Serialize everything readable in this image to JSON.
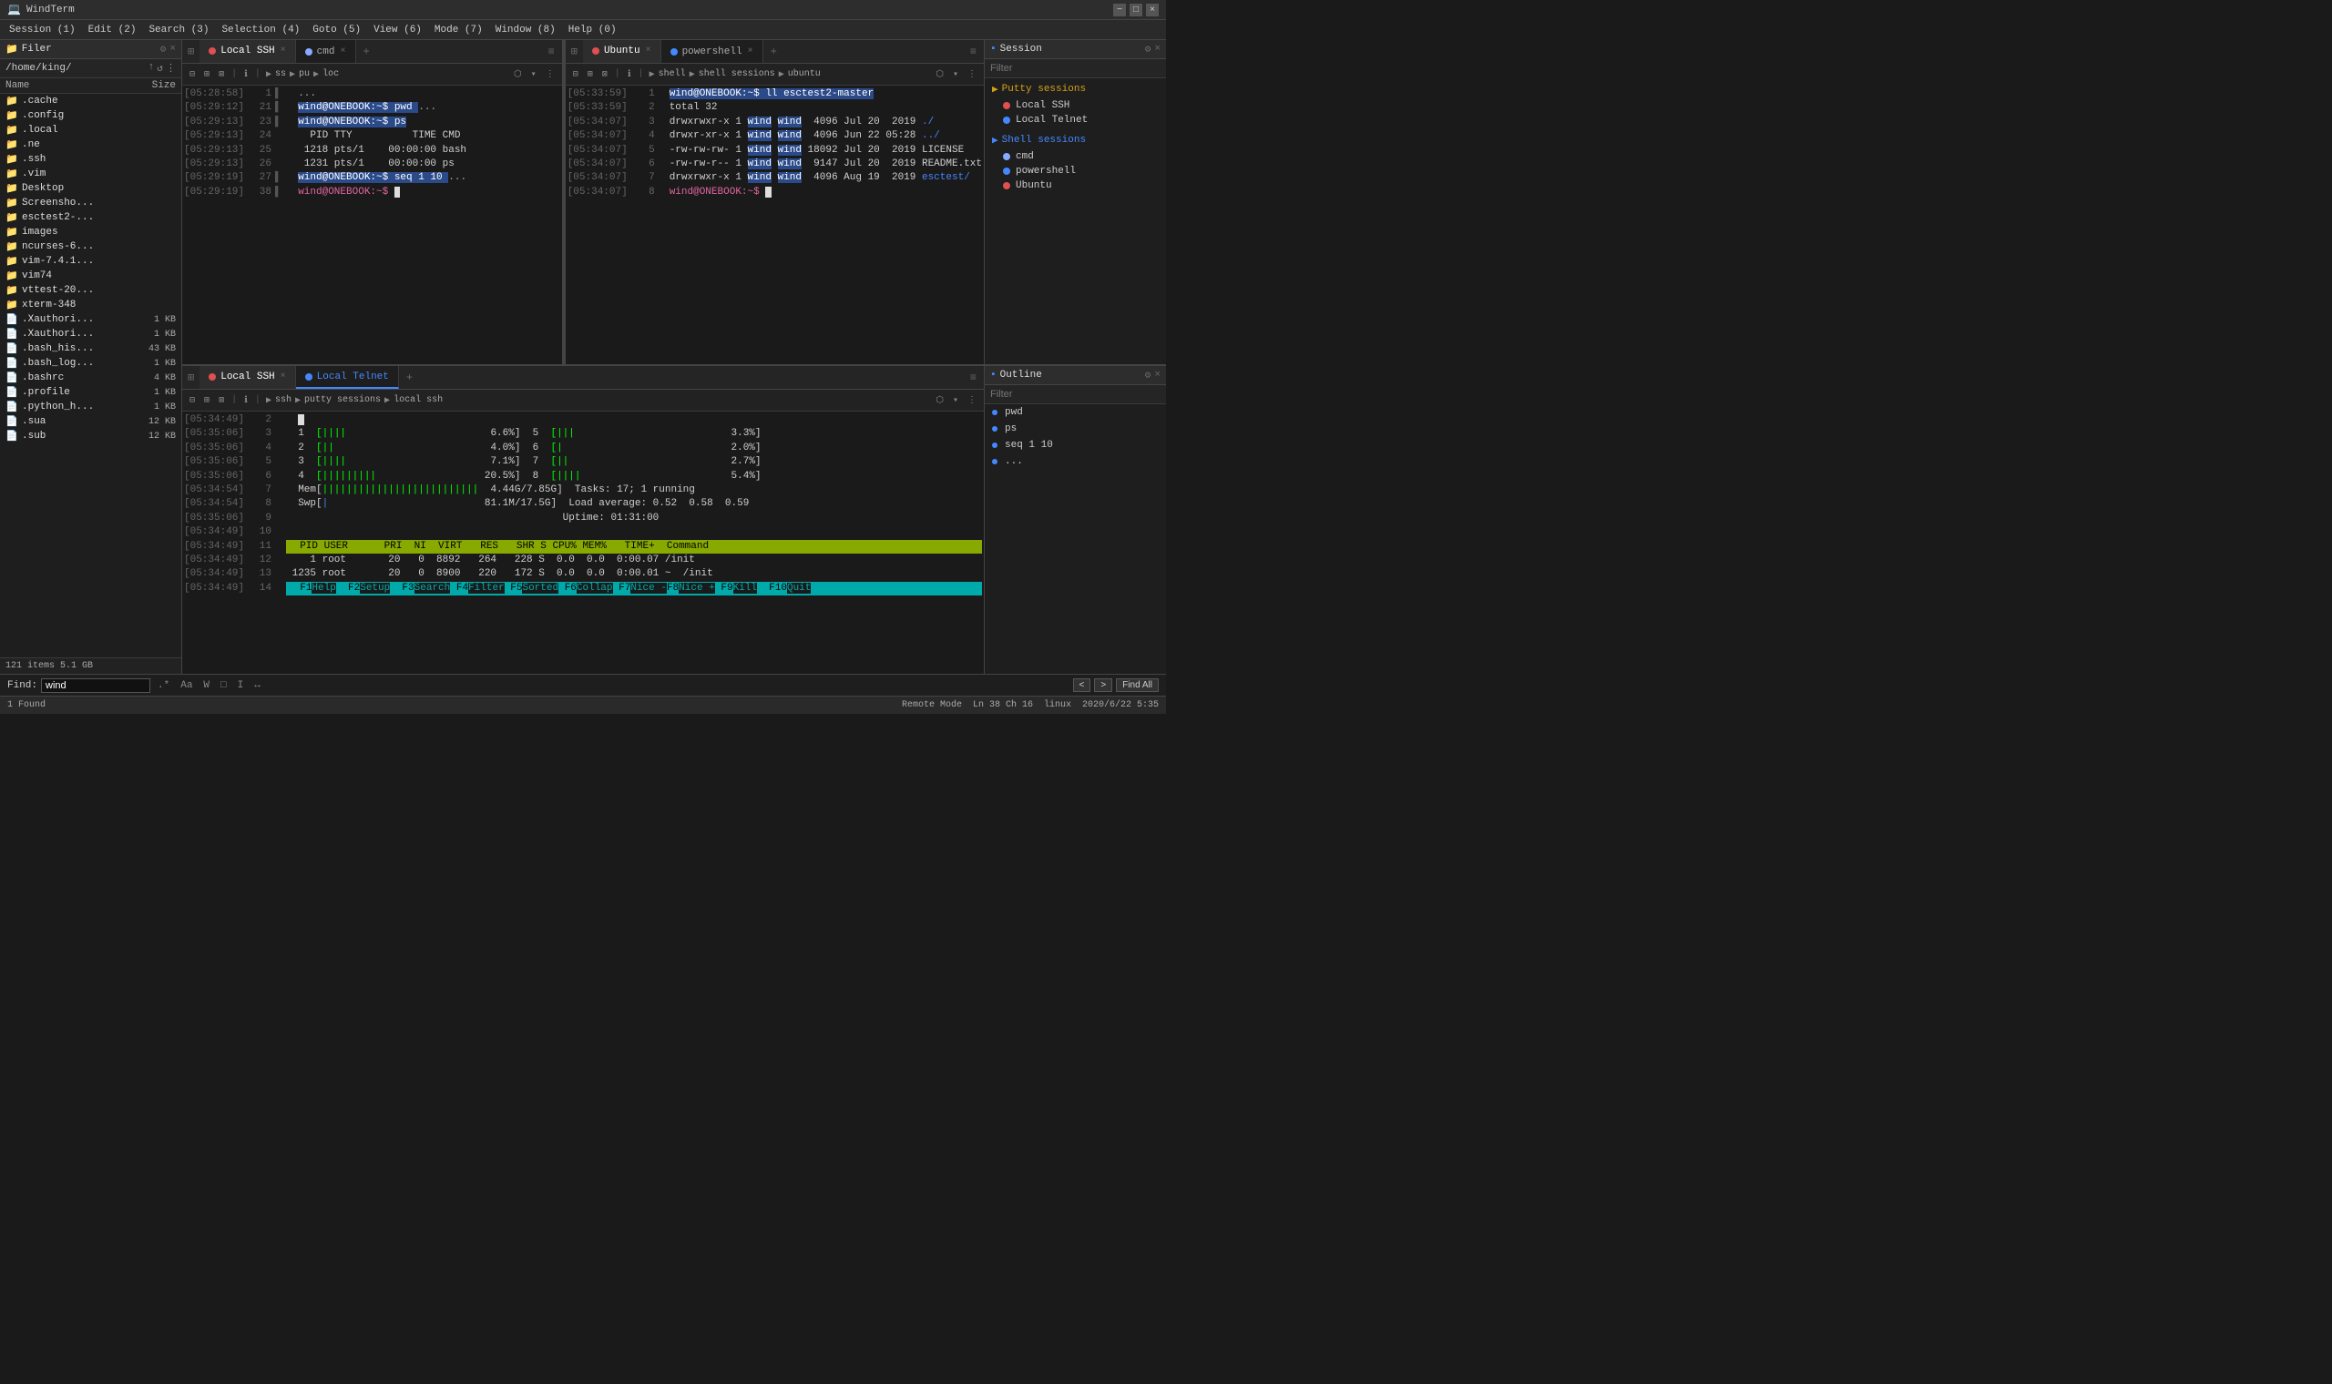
{
  "titlebar": {
    "title": "WindTerm",
    "min": "−",
    "max": "□",
    "close": "×"
  },
  "menubar": {
    "items": [
      "Session (1)",
      "Edit (2)",
      "Search (3)",
      "Selection (4)",
      "Goto (5)",
      "View (6)",
      "Mode (7)",
      "Window (8)",
      "Help (0)"
    ]
  },
  "filer": {
    "title": "Filer",
    "path": "/home/king/",
    "cols": {
      "name": "Name",
      "size": "Size"
    },
    "items": [
      {
        "name": ".cache",
        "type": "folder",
        "size": ""
      },
      {
        "name": ".config",
        "type": "folder",
        "size": ""
      },
      {
        "name": ".local",
        "type": "folder",
        "size": ""
      },
      {
        "name": ".ne",
        "type": "folder",
        "size": ""
      },
      {
        "name": ".ssh",
        "type": "folder",
        "size": ""
      },
      {
        "name": ".vim",
        "type": "folder",
        "size": ""
      },
      {
        "name": "Desktop",
        "type": "folder",
        "size": ""
      },
      {
        "name": "Screensho...",
        "type": "folder",
        "size": ""
      },
      {
        "name": "esctest2-...",
        "type": "folder",
        "size": ""
      },
      {
        "name": "images",
        "type": "folder",
        "size": ""
      },
      {
        "name": "ncurses-6...",
        "type": "folder",
        "size": ""
      },
      {
        "name": "vim-7.4.1...",
        "type": "folder",
        "size": ""
      },
      {
        "name": "vim74",
        "type": "folder",
        "size": ""
      },
      {
        "name": "vttest-20...",
        "type": "folder",
        "size": ""
      },
      {
        "name": "xterm-348",
        "type": "folder",
        "size": ""
      },
      {
        "name": ".Xauthori...",
        "type": "file",
        "size": "1 KB"
      },
      {
        "name": ".Xauthori...",
        "type": "file",
        "size": "1 KB"
      },
      {
        "name": ".bash_his...",
        "type": "file",
        "size": "43 KB"
      },
      {
        "name": ".bash_log...",
        "type": "file",
        "size": "1 KB"
      },
      {
        "name": ".bashrc",
        "type": "file",
        "size": "4 KB"
      },
      {
        "name": ".profile",
        "type": "file",
        "size": "1 KB"
      },
      {
        "name": ".python_h...",
        "type": "file",
        "size": "1 KB"
      },
      {
        "name": ".sua",
        "type": "file",
        "size": "12 KB"
      },
      {
        "name": ".sub",
        "type": "file",
        "size": "12 KB"
      }
    ],
    "footer": "121 items  5.1 GB"
  },
  "top_left": {
    "tabs": [
      {
        "label": "Local SSH",
        "dot_color": "#e05050",
        "active": true
      },
      {
        "label": "cmd",
        "dot_color": "#88aaff",
        "active": false
      }
    ],
    "toolbar": {
      "path": [
        "ss",
        "pu",
        "loc"
      ]
    },
    "lines": [
      {
        "time": "[05:28:58]",
        "num": "1",
        "ind": "▌",
        "content": "  ..."
      },
      {
        "time": "[05:29:12]",
        "num": "21",
        "ind": "▌",
        "content": "  wind@ONEBOOK:~$ pwd ..."
      },
      {
        "time": "[05:29:13]",
        "num": "23",
        "ind": "▌",
        "content": "  wind@ONEBOOK:~$ ps"
      },
      {
        "time": "[05:29:13]",
        "num": "24",
        "ind": " ",
        "content": "    PID TTY          TIME CMD"
      },
      {
        "time": "[05:29:13]",
        "num": "25",
        "ind": " ",
        "content": "   1218 pts/1    00:00:00 bash"
      },
      {
        "time": "[05:29:13]",
        "num": "26",
        "ind": " ",
        "content": "   1231 pts/1    00:00:00 ps"
      },
      {
        "time": "[05:29:19]",
        "num": "27",
        "ind": "▌",
        "content": "  wind@ONEBOOK:~$ seq 1 10 ..."
      },
      {
        "time": "[05:29:19]",
        "num": "38",
        "ind": "▌",
        "content": "  wind@ONEBOOK:~$ "
      }
    ]
  },
  "top_right": {
    "tabs": [
      {
        "label": "Ubuntu",
        "dot_color": "#e05050",
        "active": true
      },
      {
        "label": "powershell",
        "dot_color": "#4488ff",
        "active": false
      }
    ],
    "toolbar": {
      "path": [
        "shell",
        "shell sessions",
        "ubuntu"
      ]
    },
    "lines": [
      {
        "time": "[05:33:59]",
        "num": "1",
        "content": "  wind@ONEBOOK:~$ ll esctest2-master"
      },
      {
        "time": "[05:33:59]",
        "num": "2",
        "content": "  total 32"
      },
      {
        "time": "[05:34:07]",
        "num": "3",
        "content": "  drwxrwxr-x 1 wind wind  4096 Jul 20  2019 ./"
      },
      {
        "time": "[05:34:07]",
        "num": "4",
        "content": "  drwxr-xr-x 1 wind wind  4096 Jun 22 05:28 ../"
      },
      {
        "time": "[05:34:07]",
        "num": "5",
        "content": "  -rw-rw-rw- 1 wind wind 18092 Jul 20  2019 LICENSE"
      },
      {
        "time": "[05:34:07]",
        "num": "6",
        "content": "  -rw-rw-r-- 1 wind wind  9147 Jul 20  2019 README.txt"
      },
      {
        "time": "[05:34:07]",
        "num": "7",
        "content": "  drwxrwxr-x 1 wind wind  4096 Aug 19  2019 esctest/"
      },
      {
        "time": "[05:34:07]",
        "num": "8",
        "content": "  wind@ONEBOOK:~$ "
      }
    ]
  },
  "bottom": {
    "tabs": [
      {
        "label": "Local SSH",
        "dot_color": "#e05050",
        "active": true
      },
      {
        "label": "Local Telnet",
        "dot_color": "#4488ff",
        "active": false
      }
    ],
    "toolbar": {
      "path": [
        "ssh",
        "putty sessions",
        "local ssh"
      ]
    },
    "lines": [
      {
        "time": "[05:34:49]",
        "num": "2",
        "content": ""
      },
      {
        "time": "[05:35:06]",
        "num": "3",
        "content": "  1  [||||                        6.6%]  5  [|||                          3.3%]"
      },
      {
        "time": "[05:35:06]",
        "num": "4",
        "content": "  2  [||                          4.0%]  6  [|                            2.0%]"
      },
      {
        "time": "[05:35:06]",
        "num": "5",
        "content": "  3  [||||                        7.1%]  7  [||                           2.7%]"
      },
      {
        "time": "[05:35:06]",
        "num": "6",
        "content": "  4  [|||||||||                  20.5%]  8  [||||                         5.4%]"
      },
      {
        "time": "[05:34:54]",
        "num": "7",
        "content": "  Mem[||||||||||||||||||||||||||  4.44G/7.85G]  Tasks: 17; 1 running"
      },
      {
        "time": "[05:34:54]",
        "num": "8",
        "content": "  Swp[|                          81.1M/17.5G]  Load average: 0.52  0.58  0.59"
      },
      {
        "time": "[05:35:06]",
        "num": "9",
        "content": "                                              Uptime: 01:31:00"
      },
      {
        "time": "[05:34:49]",
        "num": "10",
        "content": ""
      },
      {
        "time": "[05:34:49]",
        "num": "11",
        "content": "  PID USER      PRI  NI  VIRT   RES   SHR S CPU% MEM%   TIME+  Command"
      },
      {
        "time": "[05:34:49]",
        "num": "12",
        "content": "    1 root       20   0  8892   264   228 S  0.0  0.0  0:00.07 /init"
      },
      {
        "time": "[05:34:49]",
        "num": "13",
        "content": " 1235 root       20   0  8900   220   172 S  0.0  0.0  0:00.01 ~  /init"
      },
      {
        "time": "[05:34:49]",
        "num": "14",
        "content": "  F1Help  F2Setup  F3Search F4Filter F5Sorted F6Collap F7Nice -F8Nice + F9Kill  F10Quit"
      }
    ]
  },
  "session": {
    "title": "Session",
    "filter_placeholder": "Filter",
    "groups": [
      {
        "label": "Putty sessions",
        "icon": "▶",
        "color": "#d4a017",
        "items": [
          {
            "label": "Local SSH",
            "dot_color": "#e05050"
          },
          {
            "label": "Local Telnet",
            "dot_color": "#4488ff"
          }
        ]
      },
      {
        "label": "Shell sessions",
        "icon": "▶",
        "color": "#4488ff",
        "items": [
          {
            "label": "cmd",
            "dot_color": "#88aaff"
          },
          {
            "label": "powershell",
            "dot_color": "#4488ff"
          },
          {
            "label": "Ubuntu",
            "dot_color": "#e05050"
          }
        ]
      }
    ]
  },
  "outline": {
    "title": "Outline",
    "filter_placeholder": "Filter",
    "items": [
      {
        "label": "pwd"
      },
      {
        "label": "ps"
      },
      {
        "label": "seq 1 10"
      },
      {
        "label": "..."
      }
    ]
  },
  "findbar": {
    "label": "Find:",
    "value": "wind",
    "result": "1 Found",
    "options": [
      ".*",
      "Aa",
      "W",
      "□",
      "I",
      "↔"
    ]
  },
  "statusbar": {
    "left": "1 Found",
    "items": [
      "Remote Mode",
      "Ln 38 Ch 16",
      "linux",
      "2020/6/22  5:35"
    ]
  }
}
